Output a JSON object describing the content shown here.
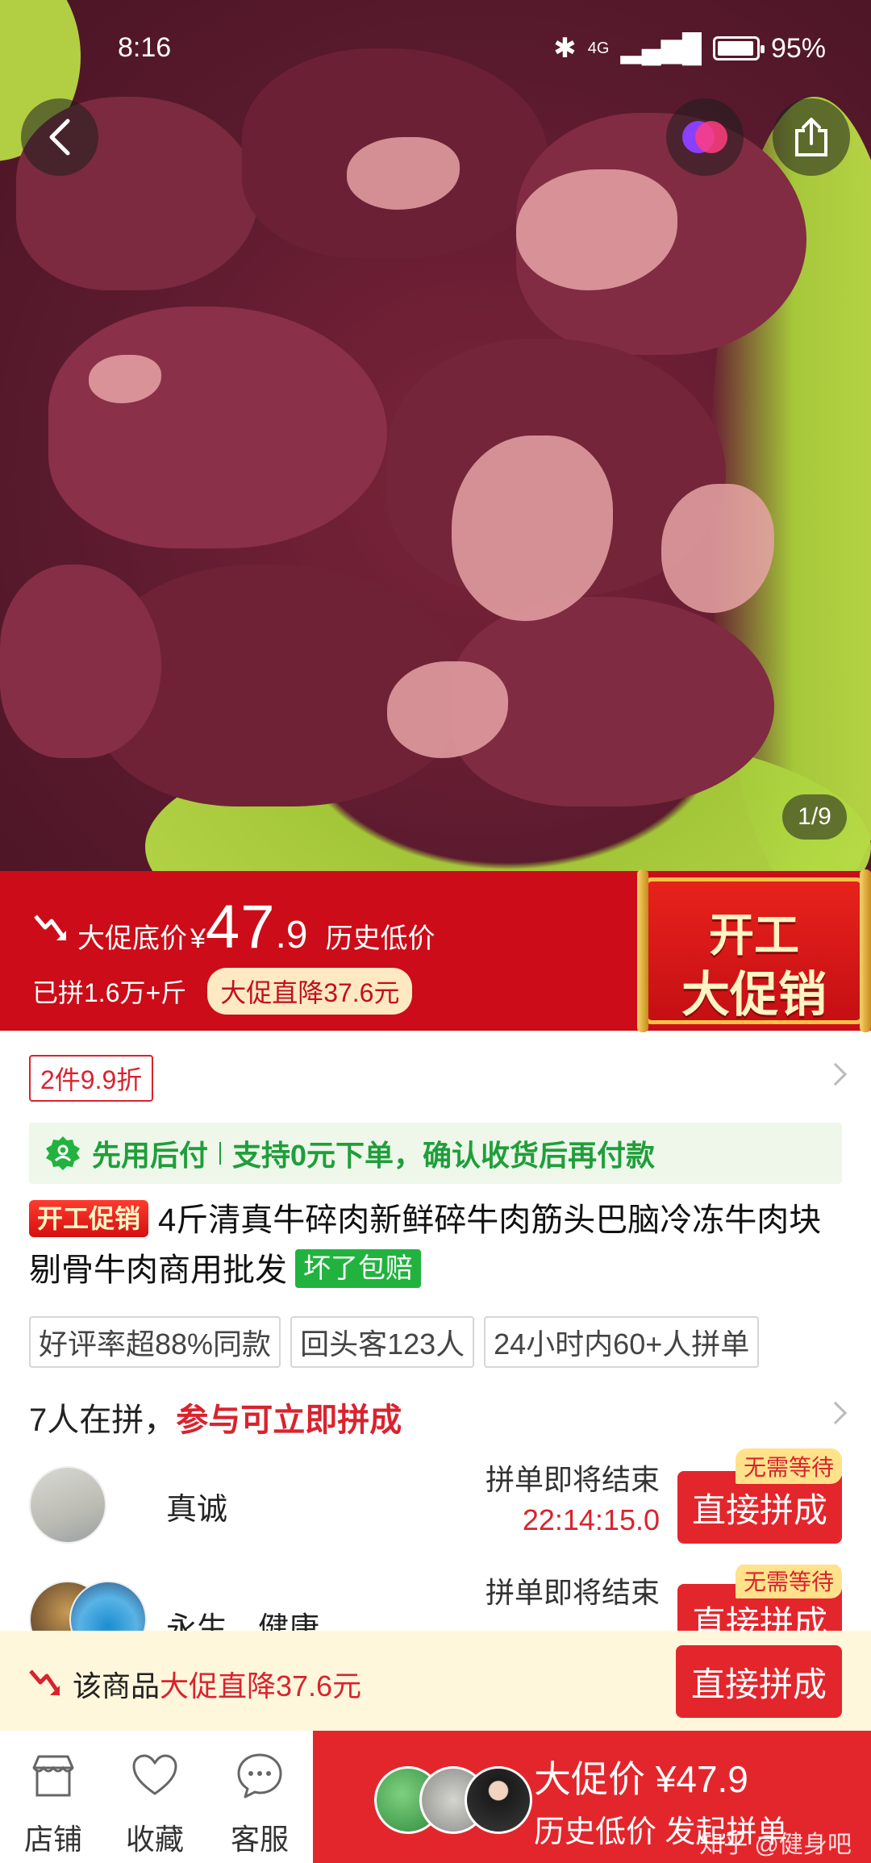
{
  "status_bar": {
    "time": "8:16",
    "network": "4G",
    "battery": "95%"
  },
  "gallery": {
    "counter": "1/9"
  },
  "promo": {
    "label": "大促底价",
    "currency": "¥",
    "price_int": "47",
    "price_dec": ".9",
    "history_low": "历史低价",
    "sold": "已拼1.6万+斤",
    "drop_badge": "大促直降37.6元",
    "banner_line1": "开工",
    "banner_line2": "大促销"
  },
  "coupon": "2件9.9折",
  "pay_later": {
    "title": "先用后付",
    "desc": "支持0元下单，确认收货后再付款"
  },
  "product": {
    "promo_tag": "开工促销",
    "title": "4斤清真牛碎肉新鲜碎牛肉筋头巴脑冷冻牛肉块剔骨牛肉商用批发",
    "guarantee_tag": "坏了包赔"
  },
  "chips": [
    "好评率超88%同款",
    "回头客123人",
    "24小时内60+人拼单"
  ],
  "group": {
    "count_text": "7人在拼，",
    "join_text": "参与可立即拼成",
    "rows": [
      {
        "name": "真诚",
        "status": "拼单即将结束",
        "countdown": "22:14:15.0",
        "button": "直接拼成",
        "badge": "无需等待"
      },
      {
        "name": "永生、健康...",
        "status": "拼单即将结束",
        "countdown": "",
        "button": "直接拼成",
        "badge": "无需等待"
      }
    ]
  },
  "notice": {
    "prefix": "该商品",
    "highlight": "大促直降37.6元",
    "button": "直接拼成"
  },
  "bottom_nav": {
    "store": "店铺",
    "favorite": "收藏",
    "service": "客服",
    "buy_line1": "大促价 ¥47.9",
    "buy_line2": "历史低价 发起拼单",
    "watermark": "知乎 @健身吧"
  },
  "colors": {
    "accent_red": "#e3262c",
    "promo_red": "#cc0c18",
    "green": "#1f9e3a"
  }
}
